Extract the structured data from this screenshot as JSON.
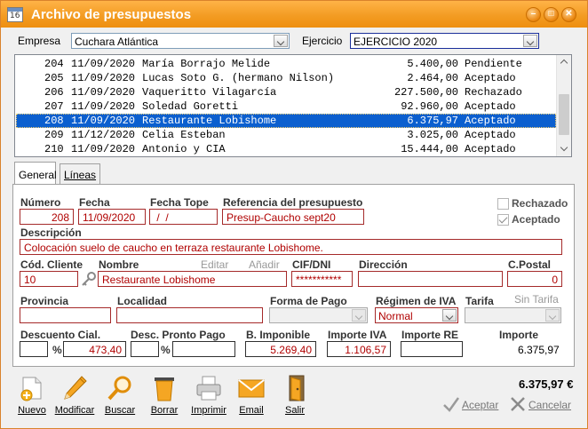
{
  "window": {
    "title": "Archivo de presupuestos",
    "icon_number": "16",
    "buttons": {
      "minimize": "–",
      "maximize": "□",
      "close": "✕"
    }
  },
  "filters": {
    "empresa_label": "Empresa",
    "empresa_value": "Cuchara Atlántica",
    "ejercicio_label": "Ejercicio",
    "ejercicio_value": "EJERCICIO 2020"
  },
  "list": {
    "rows": [
      {
        "num": "204",
        "date": "11/09/2020",
        "name": "María Borrajo Melide",
        "amount": "5.400,00",
        "state": "Pendiente"
      },
      {
        "num": "205",
        "date": "11/09/2020",
        "name": "Lucas Soto G. (hermano Nilson)",
        "amount": "2.464,00",
        "state": "Aceptado"
      },
      {
        "num": "206",
        "date": "11/09/2020",
        "name": "Vaqueritto Vilagarcía",
        "amount": "227.500,00",
        "state": "Rechazado"
      },
      {
        "num": "207",
        "date": "11/09/2020",
        "name": "Soledad Goretti",
        "amount": "92.960,00",
        "state": "Aceptado"
      },
      {
        "num": "208",
        "date": "11/09/2020",
        "name": "Restaurante Lobishome",
        "amount": "6.375,97",
        "state": "Aceptado",
        "selected": true
      },
      {
        "num": "209",
        "date": "11/12/2020",
        "name": "Celia Esteban",
        "amount": "3.025,00",
        "state": "Aceptado"
      },
      {
        "num": "210",
        "date": "11/09/2020",
        "name": "Antonio y CIA",
        "amount": "15.444,00",
        "state": "Aceptado"
      }
    ]
  },
  "tabs": [
    {
      "label": "General",
      "active": true
    },
    {
      "label": "Líneas",
      "active": false
    }
  ],
  "form": {
    "numero_label": "Número",
    "numero": "208",
    "fecha_label": "Fecha",
    "fecha": "11/09/2020",
    "fecha_tope_label": "Fecha Tope",
    "fecha_tope": " /  /",
    "referencia_label": "Referencia del presupuesto",
    "referencia": "Presup-Caucho sept20",
    "rechazado_label": "Rechazado",
    "rechazado": false,
    "aceptado_label": "Aceptado",
    "aceptado": true,
    "descripcion_label": "Descripción",
    "descripcion": "Colocación suelo de caucho en terraza restaurante Lobishome.",
    "cod_cliente_label": "Cód. Cliente",
    "cod_cliente": "10",
    "nombre_label": "Nombre",
    "nombre": "Restaurante Lobishome",
    "editar_label": "Editar",
    "anadir_label": "Añadir",
    "cif_label": "CIF/DNI",
    "cif": "***********",
    "direccion_label": "Dirección",
    "direccion": "",
    "cpostal_label": "C.Postal",
    "cpostal": "0",
    "provincia_label": "Provincia",
    "provincia": "",
    "localidad_label": "Localidad",
    "localidad": "",
    "forma_pago_label": "Forma de Pago",
    "forma_pago": "",
    "regimen_label": "Régimen de IVA",
    "regimen": "Normal",
    "tarifa_label": "Tarifa",
    "sin_tarifa_label": "Sin Tarifa",
    "tarifa": "",
    "descuento_label": "Descuento Cial.",
    "descuento_pct": "",
    "descuento_importe": "473,40",
    "pronto_pago_label": "Desc. Pronto Pago",
    "pronto_pago_pct": "",
    "pronto_pago_importe": "",
    "percent_sign": "%",
    "b_imponible_label": "B. Imponible",
    "b_imponible": "5.269,40",
    "importe_iva_label": "Importe IVA",
    "importe_iva": "1.106,57",
    "importe_re_label": "Importe RE",
    "importe_re": "",
    "importe_label": "Importe",
    "importe": "6.375,97"
  },
  "toolbar": {
    "nuevo": "Nuevo",
    "modificar": "Modificar",
    "buscar": "Buscar",
    "borrar": "Borrar",
    "imprimir": "Imprimir",
    "email": "Email",
    "salir": "Salir"
  },
  "footer": {
    "total": "6.375,97 €",
    "aceptar": "Aceptar",
    "cancelar": "Cancelar"
  },
  "colors": {
    "title_bar": "#f39c23",
    "selection": "#0b5fcf",
    "field_border": "#a52a2a",
    "field_text": "#b00000"
  }
}
